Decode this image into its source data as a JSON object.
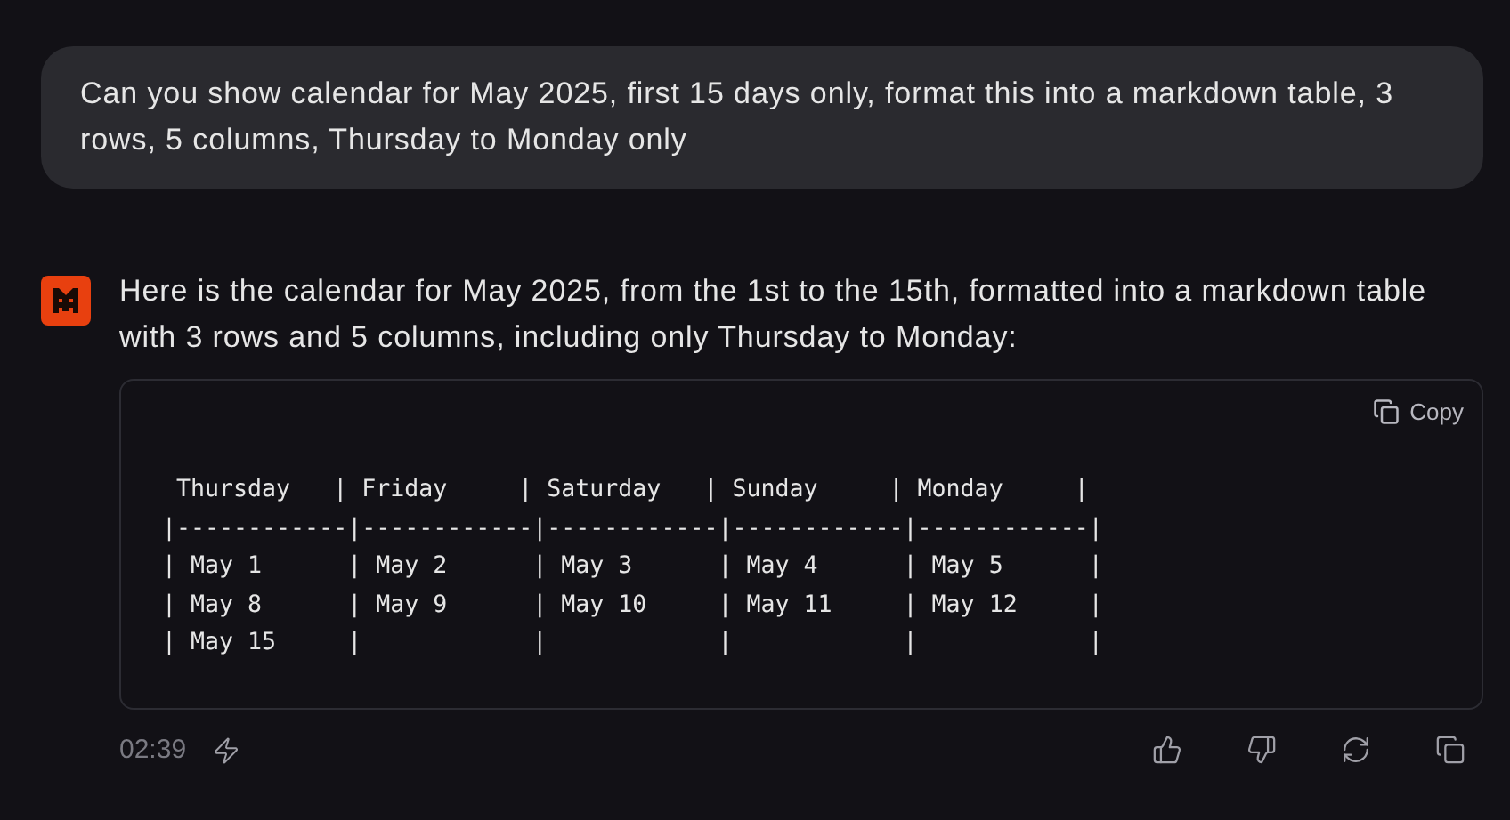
{
  "user_message": {
    "text": "Can you show calendar for May 2025, first 15 days only, format this into a markdown table, 3 rows, 5 columns, Thursday to Monday only"
  },
  "assistant_message": {
    "text": "Here is the calendar for May 2025, from the 1st to the 15th, formatted into a markdown table with 3 rows and 5 columns, including only Thursday to Monday:",
    "code_block": {
      "copy_label": "Copy",
      "lines": [
        " Thursday   | Friday     | Saturday   | Sunday     | Monday     |",
        "|------------|------------|------------|------------|------------|",
        "| May 1      | May 2      | May 3      | May 4      | May 5      |",
        "| May 8      | May 9      | May 10     | May 11     | May 12     |",
        "| May 15     |            |            |            |            |"
      ]
    },
    "time": "02:39"
  }
}
